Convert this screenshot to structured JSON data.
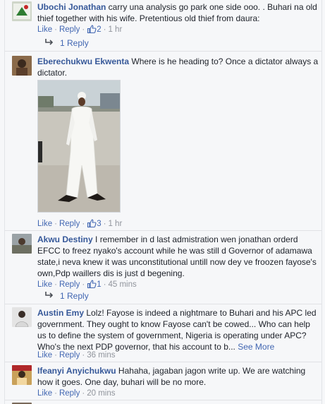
{
  "comments": [
    {
      "author": "Ubochi Jonathan",
      "text": " carry una analysis go park one side ooo. . Buhari na old thief together with his wife. Pretentious old thief from daura:",
      "like_label": "Like",
      "reply_label": "Reply",
      "likes": "2",
      "time": "1 hr",
      "replies_label": "1 Reply"
    },
    {
      "author": "Eberechukwu Ekwenta",
      "text": " Where is he heading to? Once a dictator always a dictator.",
      "like_label": "Like",
      "reply_label": "Reply",
      "likes": "3",
      "time": "1 hr"
    },
    {
      "author": "Akwu Destiny",
      "text": " I remember in d last admistration wen jonathan orderd EFCC to freez nyako's account while he was still d Governor of adamawa state,i neva knew it was unconstitutional untill now dey ve froozen fayose's own,Pdp waillers dis is just d begening.",
      "like_label": "Like",
      "reply_label": "Reply",
      "likes": "1",
      "time": "45 mins",
      "replies_label": "1 Reply"
    },
    {
      "author": "Austin Emy",
      "text": " Lolz! Fayose is indeed a nightmare to Buhari and his APC led government. They ought to know Fayose can't be cowed... Who can help us to define the system of government, Nigeria is operating under APC? Who's the next PDP governor, that his account to b...",
      "see_more": "See More",
      "like_label": "Like",
      "reply_label": "Reply",
      "time": "36 mins"
    },
    {
      "author": "Ifeanyi Anyichukwu",
      "text": " Hahaha, jagaban jagon write up. We are watching how it goes. One day, buhari will be no more.",
      "like_label": "Like",
      "reply_label": "Reply",
      "time": "20 mins"
    }
  ],
  "colors": {
    "link": "#4267b2",
    "author": "#365899",
    "meta": "#90949c",
    "background": "#f6f7f9"
  },
  "icons": {
    "like_count": "thumbs-up-icon",
    "reply_thread": "reply-arrow-icon"
  }
}
